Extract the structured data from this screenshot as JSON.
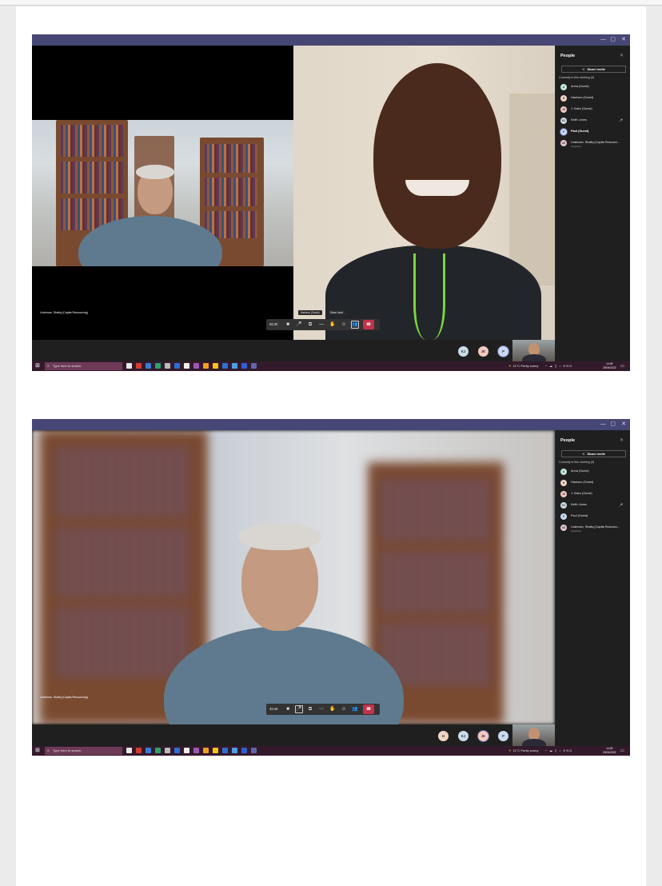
{
  "screenshots": [
    {
      "id": "top",
      "people_panel": {
        "title": "People",
        "share_invite": "Share invite",
        "section_label": "Currently in this meeting (6)",
        "participants": [
          {
            "initials": "A",
            "name": "Anna (Guest)",
            "sub": "",
            "avatar_color": "#c3e8d6"
          },
          {
            "initials": "H",
            "name": "Harrison (Guest)",
            "sub": "",
            "avatar_color": "#f2d4c4"
          },
          {
            "initials": "JK",
            "name": "J. Kalor (Guest)",
            "sub": "",
            "avatar_color": "#f4c9c0"
          },
          {
            "initials": "KJ",
            "name": "Keith Jones",
            "sub": "",
            "avatar_color": "#c9dce9"
          },
          {
            "initials": "P",
            "name": "Paul (Guest)",
            "sub": "",
            "avatar_color": "#c8d9f2"
          },
          {
            "initials": "US",
            "name": "Urahman, Shafiq (Capita Resourci...",
            "sub": "Organiser",
            "avatar_color": "#e8c4cf"
          }
        ]
      },
      "controls": {
        "timer": "06:30"
      },
      "tile_name": "Urahman, Shafiq (Capita Resourcing)",
      "tooltip_name": "Harrison (Guest)",
      "tooltip_action": "Raise hand",
      "strip_avatars": [
        "KJ",
        "JK",
        "P"
      ],
      "taskbar": {
        "search_placeholder": "Type here to search",
        "weather": "11°C  Partly sunny",
        "tray": "ENG",
        "time": "14:49",
        "date": "29/04/2022"
      }
    },
    {
      "id": "bottom",
      "people_panel": {
        "title": "People",
        "share_invite": "Share invite",
        "section_label": "Currently in this meeting (6)",
        "participants": [
          {
            "initials": "A",
            "name": "Anna (Guest)",
            "sub": "",
            "avatar_color": "#c3e8d6"
          },
          {
            "initials": "H",
            "name": "Harrison (Guest)",
            "sub": "",
            "avatar_color": "#f2d4c4"
          },
          {
            "initials": "JK",
            "name": "J. Kalor (Guest)",
            "sub": "",
            "avatar_color": "#f4c9c0"
          },
          {
            "initials": "KJ",
            "name": "Keith Jones",
            "sub": "",
            "avatar_color": "#c9dce9"
          },
          {
            "initials": "P",
            "name": "Paul (Guest)",
            "sub": "",
            "avatar_color": "#c8d9f2"
          },
          {
            "initials": "US",
            "name": "Urahman, Shafiq (Capita Resourci...",
            "sub": "Organiser",
            "avatar_color": "#e8c4cf"
          }
        ]
      },
      "controls": {
        "timer": "49:46"
      },
      "tile_name": "Urahman, Shafiq (Capita Resourcing)",
      "strip_avatars": [
        "H",
        "KJ",
        "JK",
        "P"
      ],
      "taskbar": {
        "search_placeholder": "Type here to search",
        "weather": "11°C  Partly sunny",
        "tray": "ENG",
        "time": "14:49",
        "date": "29/04/2022"
      }
    }
  ]
}
